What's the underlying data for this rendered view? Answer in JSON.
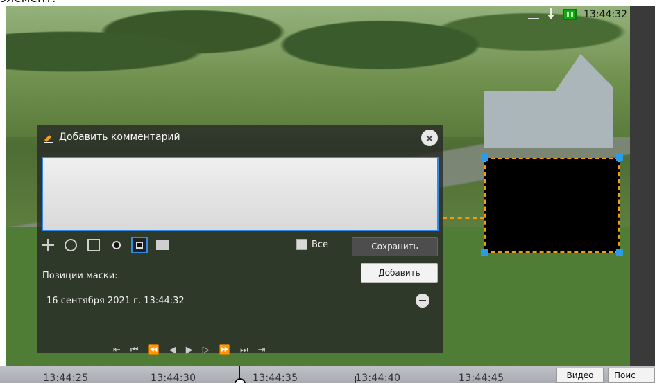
{
  "top": {
    "clipped_text": "элемент.",
    "time": "13:44:32"
  },
  "panel": {
    "title": "Добавить комментарий",
    "close_label": "×",
    "comment_value": "",
    "all_label": "Все",
    "save_label": "Сохранить",
    "add_label": "Добавить",
    "mask_positions_label": "Позиции маски:",
    "mask_positions": [
      "16 сентября 2021 г. 13:44:32"
    ],
    "playback": [
      "⇤",
      "⏮",
      "⏪",
      "◀",
      "▶",
      "▷",
      "⏩",
      "⏭",
      "⇥"
    ]
  },
  "timeline": {
    "labels": [
      "13:44:25",
      "13:44:30",
      "13:44:35",
      "13:44:40",
      "13:44:45"
    ],
    "tabs": [
      "Видео",
      "Поис"
    ]
  },
  "colors": {
    "accent_blue": "#2f8be6",
    "mask_orange": "#f29b15",
    "battery_green": "#11a811"
  },
  "icons": {
    "tools": [
      "crosshair-icon",
      "circle-outline-icon",
      "square-outline-icon",
      "circle-filled-icon",
      "square-filled-icon",
      "image-lock-icon"
    ],
    "status": [
      "pen-icon",
      "download-icon",
      "battery-icon"
    ]
  }
}
